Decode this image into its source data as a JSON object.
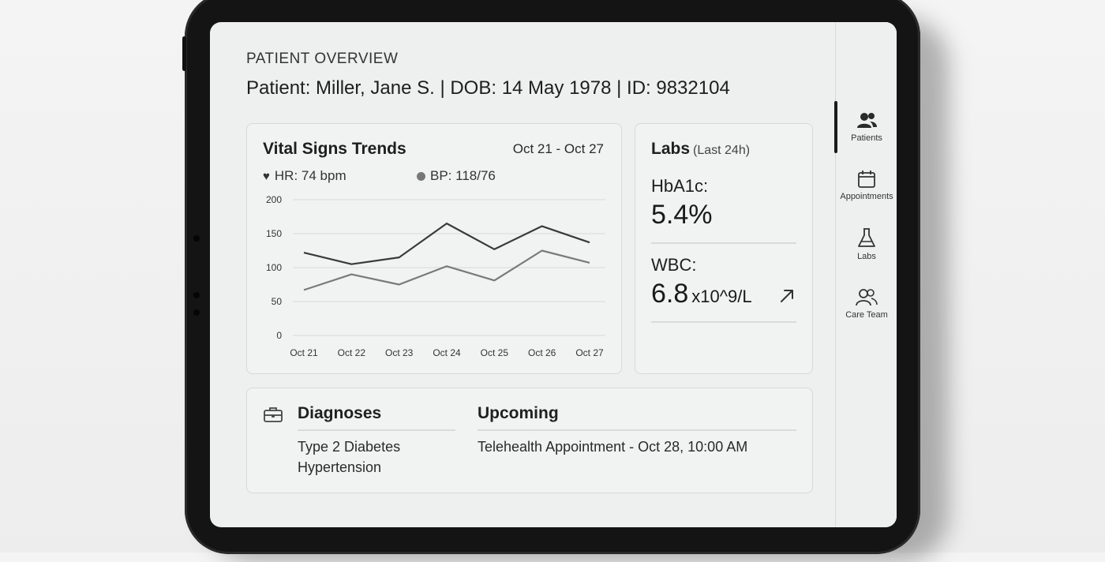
{
  "header": {
    "section_label": "PATIENT OVERVIEW",
    "patient_line": "Patient: Miller, Jane S.  |  DOB: 14 May 1978  |  ID: 9832104"
  },
  "vitals": {
    "title": "Vital Signs Trends",
    "date_range": "Oct 21 - Oct 27",
    "hr_label": "HR: 74 bpm",
    "bp_label": "BP: 118/76"
  },
  "chart_data": {
    "type": "line",
    "x": [
      "Oct 21",
      "Oct 22",
      "Oct 23",
      "Oct 24",
      "Oct 25",
      "Oct 26",
      "Oct 27"
    ],
    "series": [
      {
        "values": [
          122,
          105,
          115,
          165,
          127,
          161,
          137
        ],
        "color": "#3a3a3a"
      },
      {
        "values": [
          67,
          90,
          75,
          102,
          81,
          125,
          107
        ],
        "color": "#7a7a7a"
      }
    ],
    "yticks": [
      0,
      50,
      100,
      150,
      200
    ],
    "ylim": [
      0,
      200
    ],
    "grid": true
  },
  "labs": {
    "title": "Labs",
    "subtitle": "(Last 24h)",
    "hba1c_label": "HbA1c:",
    "hba1c_value": "5.4%",
    "wbc_label": "WBC:",
    "wbc_value": "6.8",
    "wbc_unit": "x10^9/L",
    "trend_icon": "arrow-up-right-icon"
  },
  "diagnoses": {
    "title": "Diagnoses",
    "items": [
      "Type 2 Diabetes",
      "Hypertension"
    ]
  },
  "upcoming": {
    "title": "Upcoming",
    "item": "Telehealth Appointment - Oct 28, 10:00 AM"
  },
  "sidebar": {
    "items": [
      {
        "label": "Patients",
        "icon": "users-icon",
        "active": true
      },
      {
        "label": "Appointments",
        "icon": "calendar-icon",
        "active": false
      },
      {
        "label": "Labs",
        "icon": "flask-icon",
        "active": false
      },
      {
        "label": "Care Team",
        "icon": "team-icon",
        "active": false
      }
    ]
  }
}
